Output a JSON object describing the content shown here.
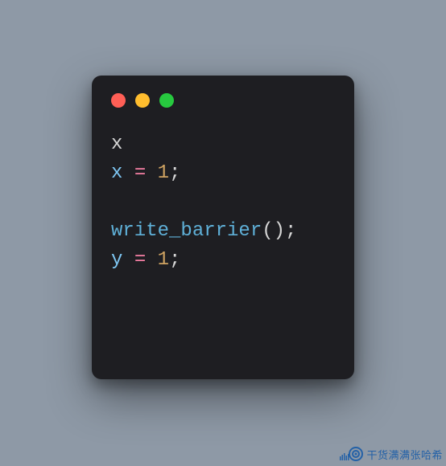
{
  "window": {
    "traffic_lights": [
      "close",
      "minimize",
      "zoom"
    ]
  },
  "code": {
    "lines": [
      [
        {
          "cls": "tok-plain",
          "t": "x"
        }
      ],
      [
        {
          "cls": "tok-var",
          "t": "x"
        },
        {
          "cls": "tok-plain",
          "t": " "
        },
        {
          "cls": "tok-op",
          "t": "="
        },
        {
          "cls": "tok-plain",
          "t": " "
        },
        {
          "cls": "tok-num",
          "t": "1"
        },
        {
          "cls": "tok-punc",
          "t": ";"
        }
      ],
      [],
      [
        {
          "cls": "tok-fn",
          "t": "write_barrier"
        },
        {
          "cls": "tok-punc",
          "t": "();"
        }
      ],
      [
        {
          "cls": "tok-var",
          "t": "y"
        },
        {
          "cls": "tok-plain",
          "t": " "
        },
        {
          "cls": "tok-op",
          "t": "="
        },
        {
          "cls": "tok-plain",
          "t": " "
        },
        {
          "cls": "tok-num",
          "t": "1"
        },
        {
          "cls": "tok-punc",
          "t": ";"
        }
      ]
    ]
  },
  "watermark": {
    "text": "干货满满张哈希"
  }
}
